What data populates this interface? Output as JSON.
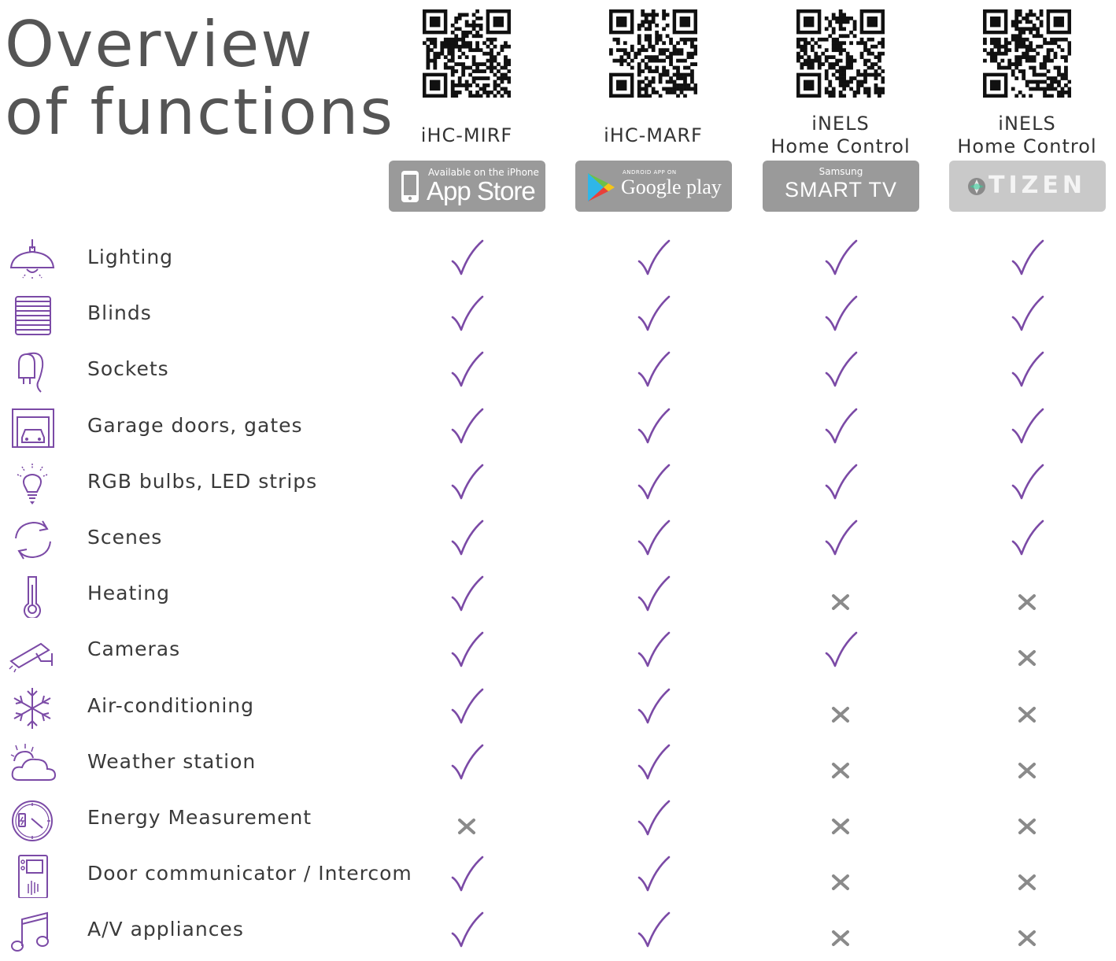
{
  "title": {
    "line1": "Overview",
    "line2": "of functions"
  },
  "columns": [
    {
      "name_lines": [
        "iHC-MIRF"
      ],
      "badge": {
        "small": "Available on the iPhone",
        "big": "App Store",
        "icon": "iphone-icon"
      }
    },
    {
      "name_lines": [
        "iHC-MARF"
      ],
      "badge": {
        "small": "ANDROID APP ON",
        "big": "Google play",
        "icon": "google-play-icon"
      }
    },
    {
      "name_lines": [
        "iNELS",
        "Home Control"
      ],
      "badge": {
        "small": "Samsung",
        "big": "SMART TV",
        "icon": "samsung-smart-tv-logo"
      }
    },
    {
      "name_lines": [
        "iNELS",
        "Home Control"
      ],
      "badge": {
        "small": "",
        "big": "TIZEN",
        "icon": "tizen-logo"
      }
    }
  ],
  "colors": {
    "accent": "#7b4aa6",
    "cross": "#8a8a8a",
    "badge_dark": "#9a9a9a",
    "badge_light": "#c9c9c9"
  },
  "rows": [
    {
      "label": "Lighting",
      "icon": "ceiling-lamp-icon",
      "support": [
        true,
        true,
        true,
        true
      ]
    },
    {
      "label": "Blinds",
      "icon": "blinds-icon",
      "support": [
        true,
        true,
        true,
        true
      ]
    },
    {
      "label": "Sockets",
      "icon": "plug-icon",
      "support": [
        true,
        true,
        true,
        true
      ]
    },
    {
      "label": "Garage doors, gates",
      "icon": "garage-icon",
      "support": [
        true,
        true,
        true,
        true
      ]
    },
    {
      "label": "RGB bulbs, LED strips",
      "icon": "bulb-icon",
      "support": [
        true,
        true,
        true,
        true
      ]
    },
    {
      "label": "Scenes",
      "icon": "scenes-icon",
      "support": [
        true,
        true,
        true,
        true
      ]
    },
    {
      "label": "Heating",
      "icon": "thermometer-icon",
      "support": [
        true,
        true,
        false,
        false
      ]
    },
    {
      "label": "Cameras",
      "icon": "camera-icon",
      "support": [
        true,
        true,
        true,
        false
      ]
    },
    {
      "label": "Air-conditioning",
      "icon": "snowflake-icon",
      "support": [
        true,
        true,
        false,
        false
      ]
    },
    {
      "label": "Weather station",
      "icon": "weather-icon",
      "support": [
        true,
        true,
        false,
        false
      ]
    },
    {
      "label": "Energy Measurement",
      "icon": "energy-meter-icon",
      "support": [
        false,
        true,
        false,
        false
      ]
    },
    {
      "label": "Door communicator / Intercom",
      "icon": "intercom-icon",
      "support": [
        true,
        true,
        false,
        false
      ]
    },
    {
      "label": "A/V appliances",
      "icon": "music-note-icon",
      "support": [
        true,
        true,
        false,
        false
      ]
    }
  ]
}
